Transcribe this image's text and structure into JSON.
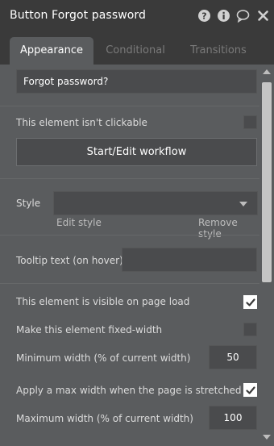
{
  "header": {
    "title": "Button Forgot password",
    "icons": [
      "help-icon",
      "info-icon",
      "comment-icon",
      "close-icon"
    ]
  },
  "tabs": [
    {
      "label": "Appearance",
      "active": true
    },
    {
      "label": "Conditional",
      "active": false
    },
    {
      "label": "Transitions",
      "active": false
    }
  ],
  "button_text": {
    "value": "Forgot password?"
  },
  "not_clickable": {
    "label": "This element isn't clickable",
    "checked": false
  },
  "workflow_button": {
    "label": "Start/Edit workflow"
  },
  "style": {
    "label": "Style",
    "selected": "",
    "edit_label": "Edit style",
    "remove_label": "Remove style"
  },
  "tooltip": {
    "label": "Tooltip text (on hover)",
    "value": ""
  },
  "visible_on_load": {
    "label": "This element is visible on page load",
    "checked": true
  },
  "fixed_width": {
    "label": "Make this element fixed-width",
    "checked": false
  },
  "min_width": {
    "label": "Minimum width (% of current width)",
    "value": "50"
  },
  "apply_max_width": {
    "label": "Apply a max width when the page is stretched",
    "checked": true
  },
  "max_width": {
    "label": "Maximum width (% of current width)",
    "value": "100"
  },
  "colors": {
    "header_bg": "#3a3a3a",
    "panel_bg": "#5a5c5e",
    "field_bg": "#4a4b4d",
    "text": "#ffffff",
    "muted_tab": "#7a7a7a"
  }
}
